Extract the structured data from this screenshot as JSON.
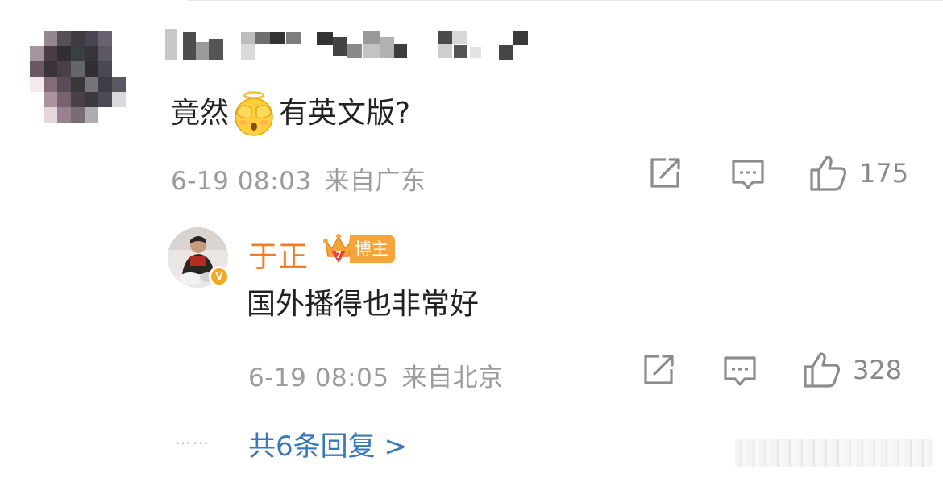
{
  "comment": {
    "text_before": "竟然",
    "emoji": "face-covering-eyes-emoji",
    "text_after": "有英文版?",
    "time": "6-19 08:03",
    "location": "来自广东",
    "likes": "175"
  },
  "reply": {
    "author": "于正",
    "badge_label": "博主",
    "badge_rank": "7",
    "verified_badge": "V",
    "text": "国外播得也非常好",
    "time": "6-19 08:05",
    "location": "来自北京",
    "likes": "328"
  },
  "footer": {
    "dots": "……",
    "more_replies": "共6条回复 >"
  },
  "icons": {
    "share": "share-icon",
    "comment": "comment-icon",
    "like": "thumbs-up-icon"
  },
  "colors": {
    "author_orange": "#f07e28",
    "link_blue": "#3a78b8",
    "meta_gray": "#9c9c9c",
    "badge_gold": "#f7a43a"
  }
}
